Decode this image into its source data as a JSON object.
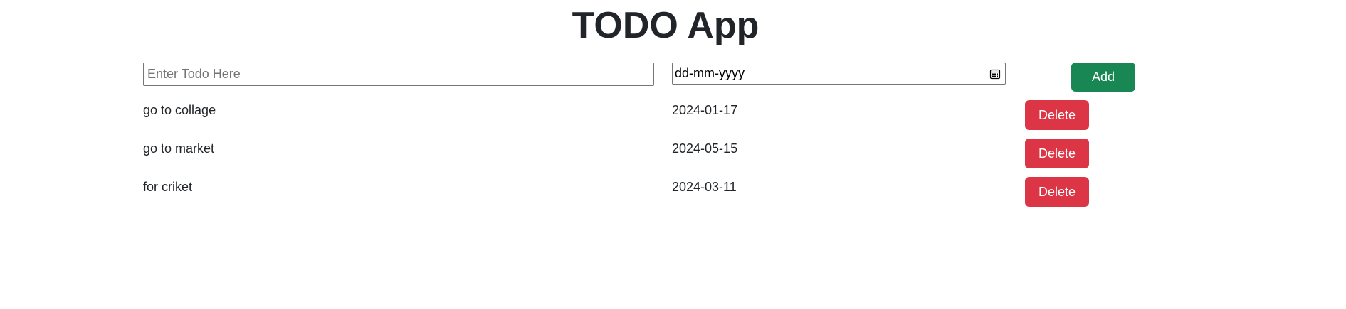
{
  "app": {
    "title": "TODO App"
  },
  "form": {
    "todo_placeholder": "Enter Todo Here",
    "todo_value": "",
    "date_placeholder": "dd-mm-yyyy",
    "add_label": "Add"
  },
  "todos": [
    {
      "name": "go to collage",
      "date": "2024-01-17",
      "delete_label": "Delete"
    },
    {
      "name": "go to market",
      "date": "2024-05-15",
      "delete_label": "Delete"
    },
    {
      "name": "for criket",
      "date": "2024-03-11",
      "delete_label": "Delete"
    }
  ],
  "colors": {
    "add_button": "#198754",
    "delete_button": "#dc3545",
    "text": "#212529"
  },
  "icons": {
    "date_picker": "calendar-icon"
  }
}
